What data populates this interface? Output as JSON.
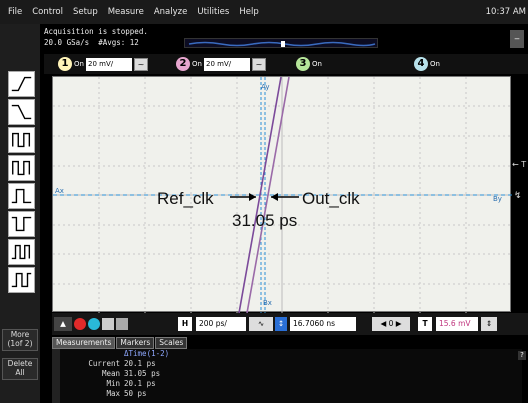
{
  "menu": {
    "items": [
      "File",
      "Control",
      "Setup",
      "Measure",
      "Analyze",
      "Utilities",
      "Help"
    ],
    "clock": "10:37 AM"
  },
  "acquisition": {
    "status": "Acquisition is stopped.",
    "rate": "20.0 GSa/s",
    "avgs": "#Avgs: 12"
  },
  "channels": [
    {
      "num": "1",
      "on": "On",
      "scale": "20 mV/",
      "color": "#fff4b8"
    },
    {
      "num": "2",
      "on": "On",
      "scale": "20 mV/",
      "color": "#e7a6cf"
    },
    {
      "num": "3",
      "on": "On",
      "color": "#b6e59a"
    },
    {
      "num": "4",
      "on": "On",
      "color": "#b7e1ea"
    }
  ],
  "sidebar": {
    "more": "More (1of 2)",
    "delete": "Delete All"
  },
  "waveform": {
    "label_left": "Ref_clk",
    "label_right": "Out_clk",
    "delta": "31.05 ps",
    "marker_ay": "Ay",
    "marker_bx": "Bx",
    "marker_ax": "Ax",
    "marker_by": "By"
  },
  "bottombar": {
    "timebase": "200 ps/",
    "delay": "16.7060 ns",
    "trigger_level": "15.6 mV",
    "h_label": "H",
    "t_label": "T"
  },
  "tabs": [
    "Measurements",
    "Markers",
    "Scales"
  ],
  "measurements": {
    "header": "ΔTime(1-2)",
    "rows": [
      {
        "label": "Current",
        "value": "20.1 ps"
      },
      {
        "label": "Mean",
        "value": "31.05 ps"
      },
      {
        "label": "Min",
        "value": "20.1 ps"
      },
      {
        "label": "Max",
        "value": "50 ps"
      }
    ]
  },
  "colors": {
    "ch1": "#fff4b8",
    "ch2": "#e7a6cf",
    "trace1": "#7b4a9a",
    "trace2": "#9a6aa8",
    "marker": "#2a8fd6"
  }
}
